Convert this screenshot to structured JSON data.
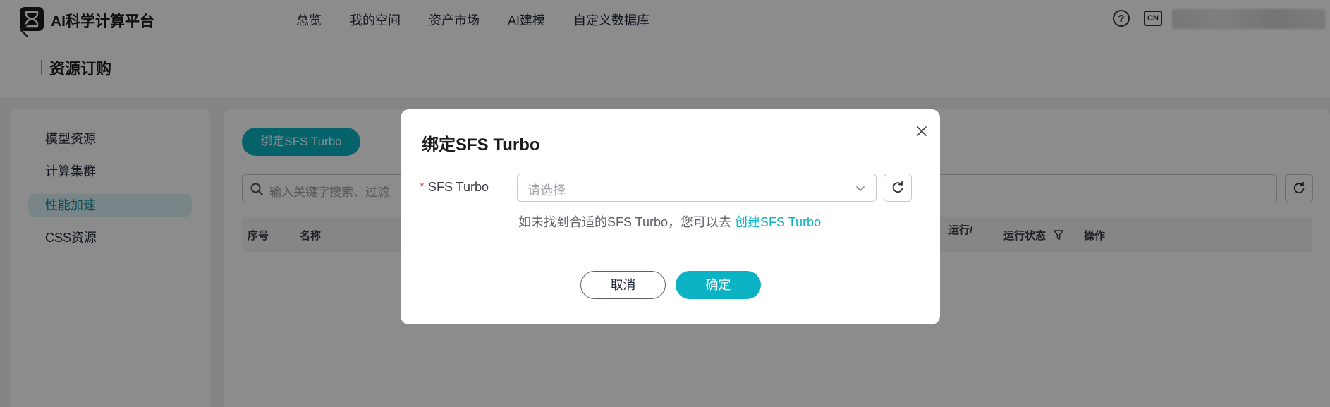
{
  "app": {
    "title": "AI科学计算平台"
  },
  "nav": {
    "items": [
      "总览",
      "我的空间",
      "资产市场",
      "AI建模",
      "自定义数据库"
    ]
  },
  "topbar": {
    "help_icon": "help-icon",
    "lang_label": "CN"
  },
  "page": {
    "title": "资源订购"
  },
  "sidebar": {
    "items": [
      {
        "label": "模型资源",
        "active": false
      },
      {
        "label": "计算集群",
        "active": false
      },
      {
        "label": "性能加速",
        "active": true
      },
      {
        "label": "CSS资源",
        "active": false
      }
    ]
  },
  "main": {
    "bind_button": "绑定SFS Turbo",
    "search_placeholder": "输入关键字搜索、过滤",
    "table_headers": [
      "序号",
      "名称",
      "运行/",
      "运行状态",
      "操作"
    ]
  },
  "modal": {
    "title": "绑定SFS Turbo",
    "required_mark": "*",
    "field_label": "SFS Turbo",
    "select_placeholder": "请选择",
    "hint_text": "如未找到合适的SFS Turbo，您可以去 ",
    "hint_link": "创建SFS Turbo",
    "cancel": "取消",
    "confirm": "确定"
  },
  "colors": {
    "accent": "#0ab2c3",
    "required": "#e14a2b"
  }
}
